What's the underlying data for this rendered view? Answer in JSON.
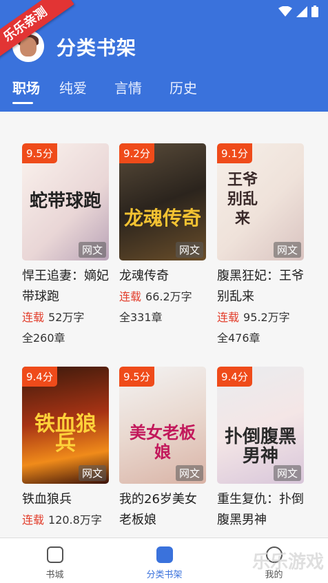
{
  "header": {
    "title": "分类书架",
    "ribbon": "乐乐亲测"
  },
  "tabs": [
    {
      "label": "职场"
    },
    {
      "label": "纯爱"
    },
    {
      "label": "言情"
    },
    {
      "label": "历史"
    }
  ],
  "books": [
    {
      "score": "9.5分",
      "source": "网文",
      "cover_text": "蛇带球跑",
      "title": "悍王追妻：嫡妃带球跑",
      "status": "连载",
      "words": "52万字",
      "chapters": "全260章"
    },
    {
      "score": "9.2分",
      "source": "网文",
      "cover_text": "龙魂传奇",
      "title": "龙魂传奇",
      "status": "连载",
      "words": "66.2万字",
      "chapters": "全331章"
    },
    {
      "score": "9.1分",
      "source": "网文",
      "cover_text": "王爷别乱来",
      "title": "腹黑狂妃：王爷别乱来",
      "status": "连载",
      "words": "95.2万字",
      "chapters": "全476章"
    },
    {
      "score": "9.4分",
      "source": "网文",
      "cover_text": "铁血狼兵",
      "title": "铁血狼兵",
      "status": "连载",
      "words": "120.8万字",
      "chapters": ""
    },
    {
      "score": "9.5分",
      "source": "网文",
      "cover_text": "美女老板娘",
      "title": "我的26岁美女老板娘",
      "status": "",
      "words": "",
      "chapters": ""
    },
    {
      "score": "9.4分",
      "source": "网文",
      "cover_text": "扑倒腹黑男神",
      "title": "重生复仇：扑倒腹黑男神",
      "status": "",
      "words": "",
      "chapters": ""
    }
  ],
  "bottom_nav": [
    {
      "label": "书城"
    },
    {
      "label": "分类书架"
    },
    {
      "label": "我的"
    }
  ],
  "watermark": "乐乐游戏",
  "colors": {
    "primary": "#3a72dc",
    "score_bg": "#ef4b1a",
    "status": "#e23d2b"
  }
}
